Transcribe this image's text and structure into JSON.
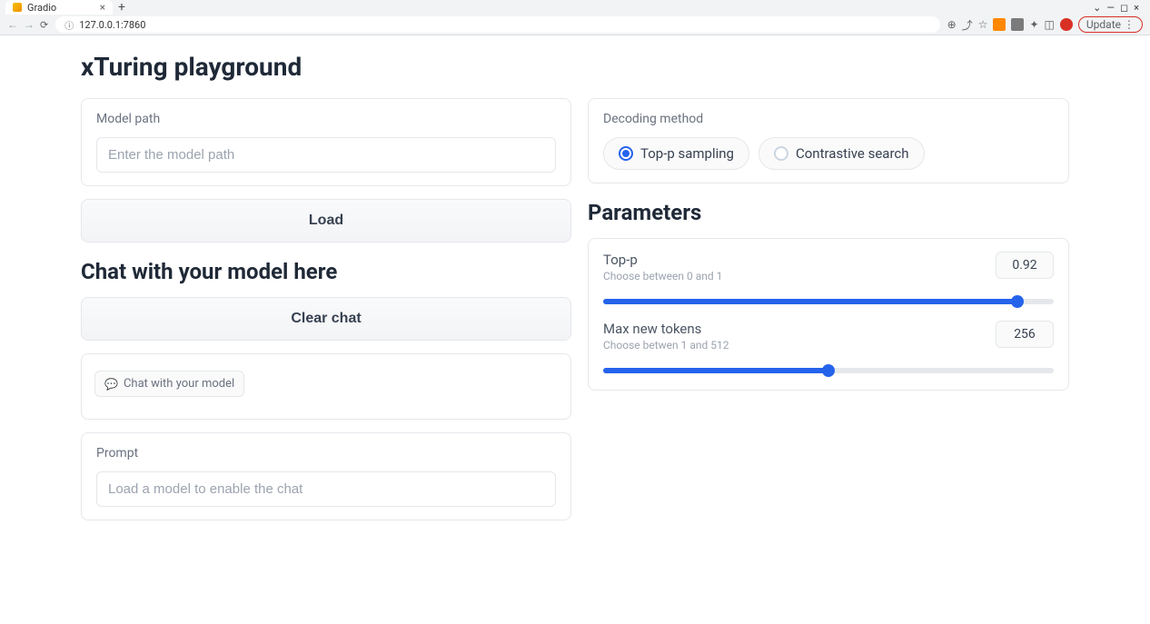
{
  "browser": {
    "tab_title": "Gradio",
    "url": "127.0.0.1:7860",
    "update_label": "Update"
  },
  "app": {
    "title": "xTuring playground"
  },
  "model_path": {
    "label": "Model path",
    "placeholder": "Enter the model path"
  },
  "buttons": {
    "load": "Load",
    "clear_chat": "Clear chat"
  },
  "chat": {
    "section_title": "Chat with your model here",
    "empty_chip": "Chat with your model"
  },
  "prompt": {
    "label": "Prompt",
    "placeholder": "Load a model to enable the chat"
  },
  "decoding": {
    "label": "Decoding method",
    "options": {
      "top_p": "Top-p sampling",
      "contrastive": "Contrastive search"
    },
    "selected": "top_p"
  },
  "parameters": {
    "section_title": "Parameters",
    "top_p": {
      "label": "Top-p",
      "desc": "Choose between 0 and 1",
      "value": "0.92"
    },
    "max_new_tokens": {
      "label": "Max new tokens",
      "desc": "Choose betwen 1 and 512",
      "value": "256"
    }
  }
}
